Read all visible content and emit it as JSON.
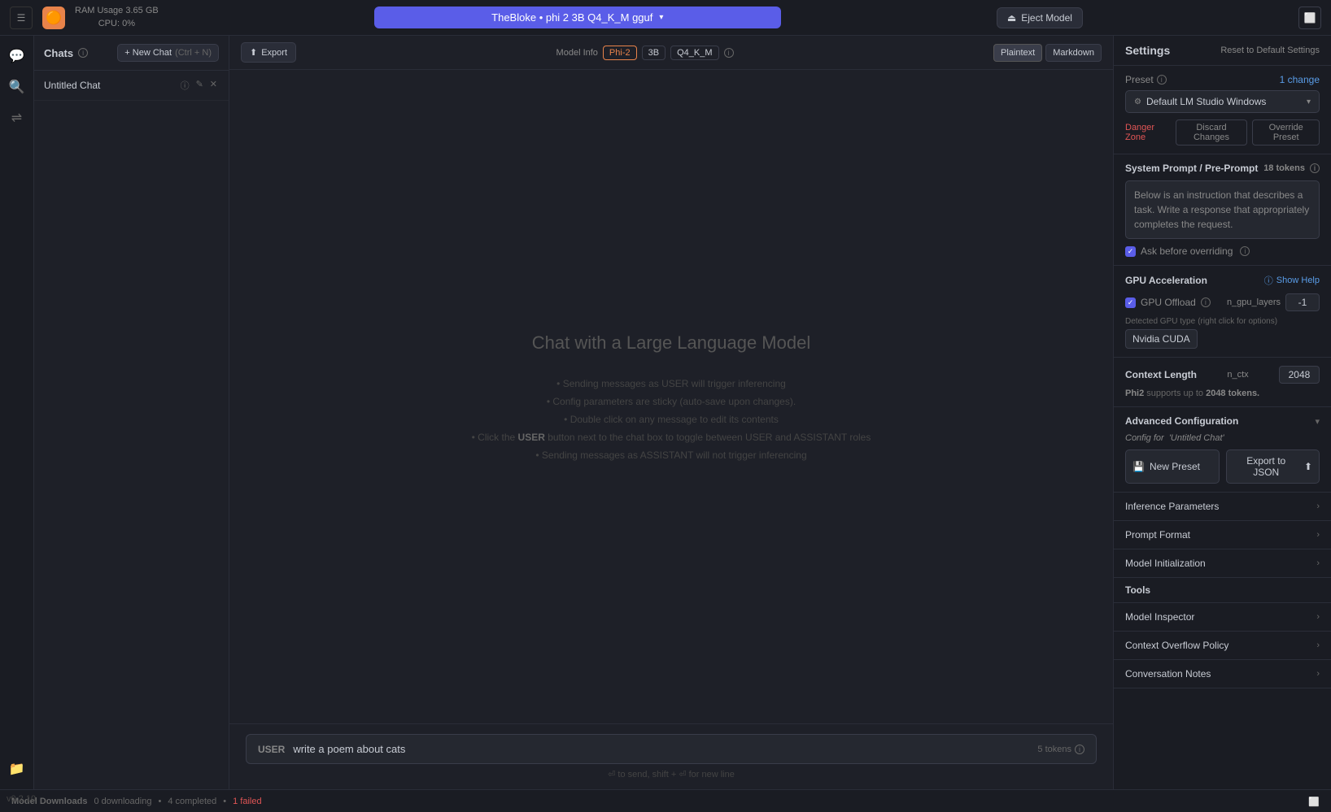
{
  "topbar": {
    "logo": "🟠",
    "menu_icon": "☰",
    "ram_label": "RAM Usage",
    "ram_value": "3.65 GB",
    "cpu_label": "CPU:",
    "cpu_value": "0%",
    "model_name": "TheBloke • phi 2 3B Q4_K_M gguf",
    "chevron": "▾",
    "eject_label": "Eject Model",
    "eject_icon": "⏏"
  },
  "chat_list": {
    "title": "Chats",
    "info_icon": "ⓘ",
    "new_chat_label": "+ New Chat",
    "new_chat_shortcut": "(Ctrl + N)",
    "chat_item_name": "Untitled Chat",
    "chat_info_icon": "ⓘ",
    "chat_edit_icon": "✎",
    "chat_close_icon": "✕"
  },
  "chat_toolbar": {
    "export_label": "Export",
    "export_icon": "⬆",
    "model_info_label": "Model Info",
    "tag_phi2": "Phi-2",
    "tag_3b": "3B",
    "tag_q4km": "Q4_K_M",
    "info_icon": "ⓘ",
    "format_plaintext": "Plaintext",
    "format_markdown": "Markdown"
  },
  "chat_content": {
    "welcome_title": "Chat with a Large Language Model",
    "hints": [
      "• Sending messages as USER will trigger inferencing",
      "• Config parameters are sticky (auto-save upon changes).",
      "• Double click on any message to edit its contents",
      "• Click the USER button next to the chat box to toggle between USER and ASSISTANT roles",
      "• Sending messages as ASSISTANT will not trigger inferencing"
    ]
  },
  "chat_input": {
    "user_label": "USER",
    "input_value": "write a poem about cats",
    "token_count": "5 tokens",
    "info_icon": "ⓘ",
    "hint": "⏎ to send, shift + ⏎ for new line"
  },
  "settings": {
    "title": "Settings",
    "reset_btn": "Reset to Default Settings",
    "preset_label": "Preset",
    "preset_info": "ⓘ",
    "preset_change": "1 change",
    "preset_icon": "⚙",
    "preset_name": "Default LM Studio Windows",
    "preset_chevron": "▾",
    "danger_zone": "Danger Zone",
    "discard_changes": "Discard Changes",
    "override_preset": "Override Preset",
    "system_prompt_title": "System Prompt / Pre-Prompt",
    "token_count": "18 tokens",
    "info_icon": "ⓘ",
    "system_prompt_text": "Below is an instruction that describes a task. Write a response that appropriately completes the request.",
    "ask_before_label": "Ask before overriding",
    "ask_before_info": "ⓘ",
    "gpu_title": "GPU Acceleration",
    "show_help": "Show Help",
    "help_icon": "ⓘ",
    "gpu_offload_label": "GPU Offload",
    "gpu_offload_info": "ⓘ",
    "n_gpu_layers_label": "n_gpu_layers",
    "n_gpu_layers_value": "-1",
    "detected_gpu_label": "Detected GPU type",
    "detected_gpu_note": "(right click for options)",
    "gpu_value": "Nvidia CUDA",
    "context_title": "Context Length",
    "n_ctx_label": "n_ctx",
    "n_ctx_value": "2048",
    "context_note_model": "Phi2",
    "context_note_supports": "supports up to",
    "context_note_tokens": "2048 tokens.",
    "advanced_config_title": "Advanced Configuration",
    "advanced_chevron": "▾",
    "config_for_label": "Config for",
    "config_for_value": "'Untitled Chat'",
    "new_preset_label": "New Preset",
    "new_preset_icon": "💾",
    "export_json_label": "Export to JSON",
    "export_json_icon": "⬆",
    "inference_params": "Inference Parameters",
    "prompt_format": "Prompt Format",
    "model_initialization": "Model Initialization",
    "tools_title": "Tools",
    "model_inspector": "Model Inspector",
    "context_overflow": "Context Overflow Policy",
    "conversation_notes": "Conversation Notes"
  },
  "bottom_bar": {
    "label": "Model Downloads",
    "downloading": "0 downloading",
    "separator": "•",
    "completed": "4 completed",
    "separator2": "•",
    "failed": "1 failed"
  },
  "version": "v0.2.10",
  "icons": {
    "chat": "💬",
    "arrows": "⇌",
    "folder": "📁",
    "chevron_right": "›"
  }
}
